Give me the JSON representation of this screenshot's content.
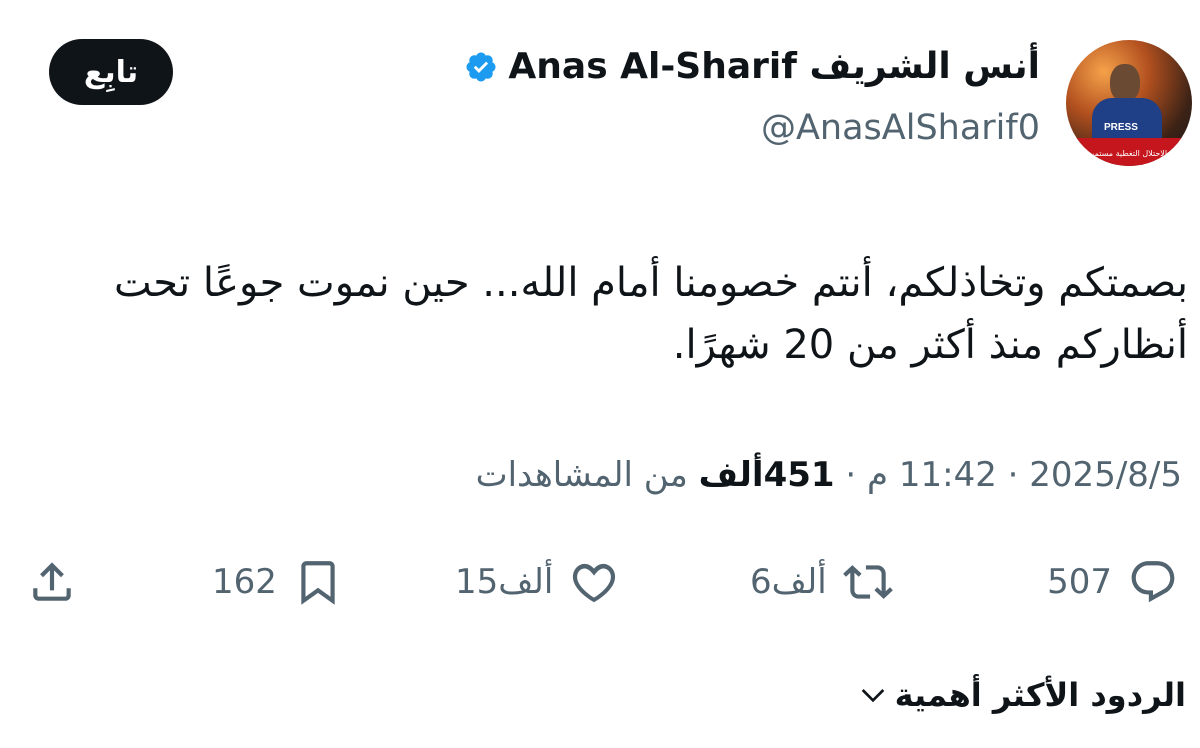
{
  "author": {
    "display_name": "أنس الشريف Anas Al-Sharif",
    "handle": "@AnasAlSharif0",
    "avatar_badge": "PRESS",
    "avatar_banner": "قوات الاحتلال التغطية مستمرة"
  },
  "follow_button": "تابِع",
  "tweet": {
    "text": "بصمتكم وتخاذلكم، أنتم خصومنا أمام الله... حين نموت جوعًا تحت أنظاركم منذ أكثر من 20 شهرًا."
  },
  "meta": {
    "date": "2025/8/5",
    "time": "11:42 م",
    "separator": " · ",
    "views_count": "451ألف",
    "views_label": " من المشاهدات"
  },
  "actions": {
    "replies": "507",
    "retweets": "6ألف",
    "likes": "15ألف",
    "bookmarks": "162"
  },
  "top_replies_label": "الردود الأكثر أهمية",
  "colors": {
    "text": "#0f1419",
    "muted": "#536471",
    "verified": "#1d9bf0",
    "button_bg": "#0f1419"
  }
}
